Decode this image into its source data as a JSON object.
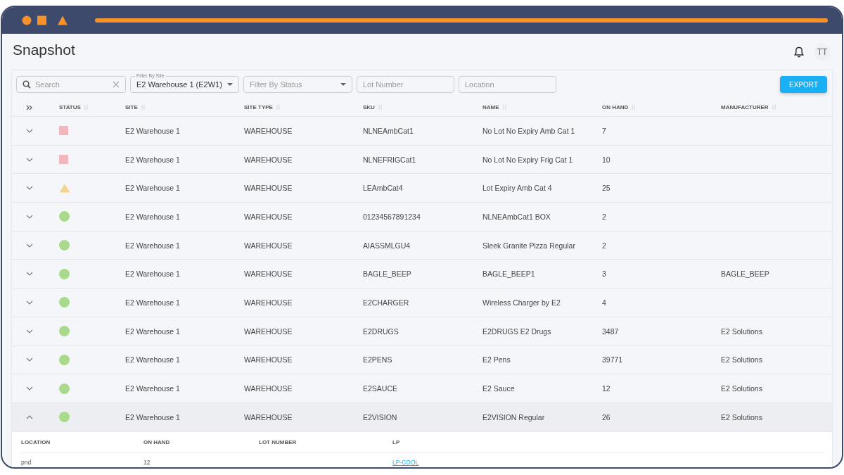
{
  "page_title": "Snapshot",
  "avatar": "TT",
  "filters": [
    {
      "kind": "search",
      "placeholder": "Search"
    },
    {
      "kind": "select",
      "label": "Filter By Site",
      "value": "E2 Warehouse 1 (E2W1)"
    },
    {
      "kind": "select",
      "placeholder": "Filter By Status"
    },
    {
      "kind": "text",
      "placeholder": "Lot Number"
    },
    {
      "kind": "text",
      "placeholder": "Location"
    }
  ],
  "export_button": "EXPORT",
  "table": {
    "columns": [
      "STATUS",
      "SITE",
      "SITE TYPE",
      "SKU",
      "NAME",
      "ON HAND",
      "MANUFACTURER"
    ],
    "rows": [
      {
        "expanded": false,
        "status": {
          "kind": "square",
          "color": "#f2b6bc"
        },
        "site": "E2 Warehouse 1",
        "site_type": "WAREHOUSE",
        "sku": "NLNEAmbCat1",
        "name": "No Lot No Expiry Amb Cat 1",
        "on_hand": "7"
      },
      {
        "expanded": false,
        "status": {
          "kind": "square",
          "color": "#f2b6bc"
        },
        "site": "E2 Warehouse 1",
        "site_type": "WAREHOUSE",
        "sku": "NLNEFRIGCat1",
        "name": "No Lot No Expiry Frig Cat 1",
        "on_hand": "10"
      },
      {
        "expanded": false,
        "status": {
          "kind": "triangle",
          "color": "#f2d48e"
        },
        "site": "E2 Warehouse 1",
        "site_type": "WAREHOUSE",
        "sku": "LEAmbCat4",
        "name": "Lot Expiry Amb Cat 4",
        "on_hand": "25"
      },
      {
        "expanded": false,
        "status": {
          "kind": "circle",
          "color": "#a9da8c"
        },
        "site": "E2 Warehouse 1",
        "site_type": "WAREHOUSE",
        "sku": "01234567891234",
        "name": "NLNEAmbCat1 BOX",
        "on_hand": "2"
      },
      {
        "expanded": false,
        "status": {
          "kind": "circle",
          "color": "#a9da8c"
        },
        "site": "E2 Warehouse 1",
        "site_type": "WAREHOUSE",
        "sku": "AIASSMLGU4",
        "name": "Sleek Granite Pizza Regular",
        "on_hand": "2"
      },
      {
        "expanded": false,
        "status": {
          "kind": "circle",
          "color": "#a9da8c"
        },
        "site": "E2 Warehouse 1",
        "site_type": "WAREHOUSE",
        "sku": "BAGLE_BEEP",
        "name": "BAGLE_BEEP1",
        "on_hand": "3",
        "manufacturer": "BAGLE_BEEP"
      },
      {
        "expanded": false,
        "status": {
          "kind": "circle",
          "color": "#a9da8c"
        },
        "site": "E2 Warehouse 1",
        "site_type": "WAREHOUSE",
        "sku": "E2CHARGER",
        "name": "Wireless Charger by E2",
        "on_hand": "4"
      },
      {
        "expanded": false,
        "status": {
          "kind": "circle",
          "color": "#a9da8c"
        },
        "site": "E2 Warehouse 1",
        "site_type": "WAREHOUSE",
        "sku": "E2DRUGS",
        "name": "E2DRUGS E2 Drugs",
        "on_hand": "3487",
        "manufacturer": "E2 Solutions"
      },
      {
        "expanded": false,
        "status": {
          "kind": "circle",
          "color": "#a9da8c"
        },
        "site": "E2 Warehouse 1",
        "site_type": "WAREHOUSE",
        "sku": "E2PENS",
        "name": "E2 Pens",
        "on_hand": "39771",
        "manufacturer": "E2 Solutions"
      },
      {
        "expanded": false,
        "status": {
          "kind": "circle",
          "color": "#a9da8c"
        },
        "site": "E2 Warehouse 1",
        "site_type": "WAREHOUSE",
        "sku": "E2SAUCE",
        "name": "E2 Sauce",
        "on_hand": "12",
        "manufacturer": "E2 Solutions"
      },
      {
        "expanded": true,
        "status": {
          "kind": "circle",
          "color": "#a9da8c"
        },
        "site": "E2 Warehouse 1",
        "site_type": "WAREHOUSE",
        "sku": "E2VISION",
        "name": "E2VISION Regular",
        "on_hand": "26",
        "manufacturer": "E2 Solutions",
        "detail": {
          "columns": [
            "LOCATION",
            "ON HAND",
            "LOT NUMBER",
            "LP"
          ],
          "rows": [
            {
              "location": "pnd",
              "on_hand": "12",
              "lp": "LP-COOL"
            }
          ]
        }
      }
    ]
  }
}
